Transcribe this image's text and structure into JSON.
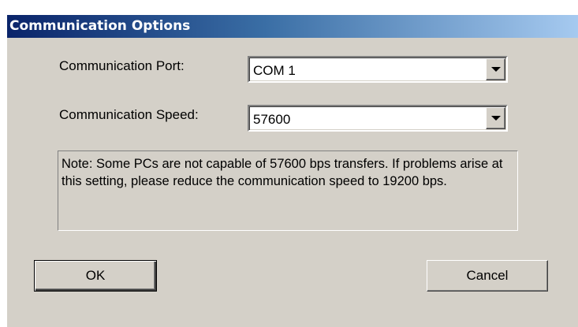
{
  "dialog": {
    "title": "Communication Options",
    "port": {
      "label": "Communication Port:",
      "value": "COM 1"
    },
    "speed": {
      "label": "Communication Speed:",
      "value": "57600"
    },
    "note": "Note: Some PCs are not capable of 57600 bps transfers. If problems arise at this setting, please reduce the communication speed to 19200 bps.",
    "ok_label": "OK",
    "cancel_label": "Cancel"
  },
  "colors": {
    "dialog_face": "#d4d0c8",
    "title_start": "#0a246a",
    "title_end": "#a6caf0"
  }
}
